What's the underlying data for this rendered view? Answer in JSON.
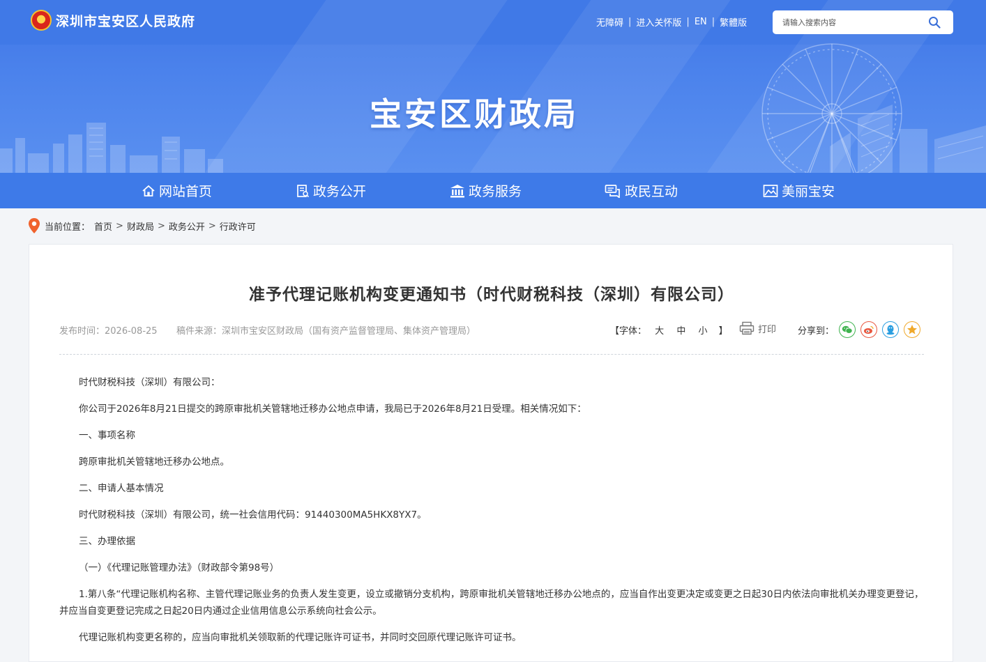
{
  "header": {
    "site_name": "深圳市宝安区人民政府",
    "links": [
      "无障碍",
      "进入关怀版",
      "EN",
      "繁體版"
    ],
    "search_placeholder": "请输入搜索内容",
    "dept_title": "宝安区财政局"
  },
  "nav": {
    "items": [
      {
        "label": "网站首页",
        "icon": "home-icon"
      },
      {
        "label": "政务公开",
        "icon": "document-icon"
      },
      {
        "label": "政务服务",
        "icon": "government-building-icon"
      },
      {
        "label": "政民互动",
        "icon": "chat-icon"
      },
      {
        "label": "美丽宝安",
        "icon": "picture-icon"
      }
    ]
  },
  "breadcrumb": {
    "label": "当前位置：",
    "items": [
      "首页",
      "财政局",
      "政务公开",
      "行政许可"
    ],
    "separator": ">"
  },
  "article": {
    "title": "准予代理记账机构变更通知书（时代财税科技（深圳）有限公司）",
    "pub_date": "发布时间：2026-08-25",
    "source": "稿件来源：深圳市宝安区财政局（国有资产监督管理局、集体资产管理局）",
    "font_label": "【字体：",
    "font_sizes": [
      "大",
      "中",
      "小"
    ],
    "font_close": "】",
    "print_label": "打印",
    "share_label": "分享到：",
    "share_targets": [
      {
        "icon": "wechat-icon",
        "color": "#3fb34f"
      },
      {
        "icon": "weibo-icon",
        "color": "#e9573f"
      },
      {
        "icon": "qq-icon",
        "color": "#2a9ee0"
      },
      {
        "icon": "qzone-icon",
        "color": "#f0a92b"
      }
    ],
    "paragraphs": [
      "时代财税科技（深圳）有限公司：",
      "你公司于2026年8月21日提交的跨原审批机关管辖地迁移办公地点申请，我局已于2026年8月21日受理。相关情况如下：",
      "一、事项名称",
      "跨原审批机关管辖地迁移办公地点。",
      "二、申请人基本情况",
      "时代财税科技（深圳）有限公司，统一社会信用代码：91440300MA5HKX8YX7。",
      "三、办理依据",
      "（一）《代理记账管理办法》（财政部令第98号）",
      "1.第八条“代理记账机构名称、主管代理记账业务的负责人发生变更，设立或撤销分支机构，跨原审批机关管辖地迁移办公地点的，应当自作出变更决定或变更之日起30日内依法向审批机关办理变更登记，并应当自变更登记完成之日起20日内通过企业信用信息公示系统向社会公示。",
      "代理记账机构变更名称的，应当向审批机关领取新的代理记账许可证书，并同时交回原代理记账许可证书。"
    ]
  },
  "colors": {
    "banner_blue": "#4c83ec",
    "nav_blue": "#3e7ae8",
    "pin_orange": "#f0622d"
  }
}
